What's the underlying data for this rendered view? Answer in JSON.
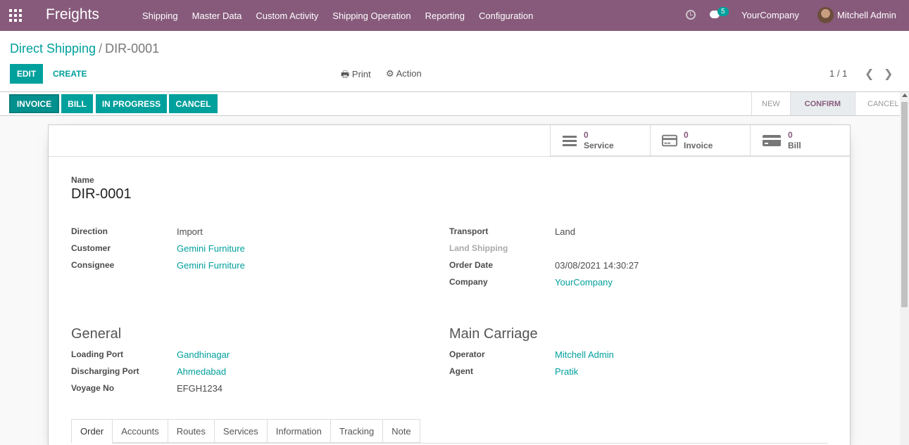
{
  "navbar": {
    "brand": "Freights",
    "menu": [
      "Shipping",
      "Master Data",
      "Custom Activity",
      "Shipping Operation",
      "Reporting",
      "Configuration"
    ],
    "message_count": "5",
    "company": "YourCompany",
    "user": "Mitchell Admin"
  },
  "breadcrumb": {
    "parent": "Direct Shipping",
    "separator": "/",
    "current": "DIR-0001"
  },
  "toolbar": {
    "edit_label": "EDIT",
    "create_label": "CREATE",
    "print_label": "Print",
    "action_label": "Action",
    "pager": "1 / 1"
  },
  "statusbar": {
    "buttons": [
      "INVOICE",
      "BILL",
      "IN PROGRESS",
      "CANCEL"
    ],
    "stages": [
      "NEW",
      "CONFIRM",
      "CANCEL"
    ],
    "active_stage": "CONFIRM"
  },
  "smart_buttons": [
    {
      "count": "0",
      "label": "Service",
      "icon": "list-icon"
    },
    {
      "count": "0",
      "label": "Invoice",
      "icon": "credit-card-icon"
    },
    {
      "count": "0",
      "label": "Bill",
      "icon": "credit-card-icon"
    }
  ],
  "record": {
    "name_label": "Name",
    "name": "DIR-0001",
    "left_fields": [
      {
        "label": "Direction",
        "value": "Import"
      },
      {
        "label": "Customer",
        "value": "Gemini Furniture"
      },
      {
        "label": "Consignee",
        "value": "Gemini Furniture"
      }
    ],
    "right_fields": [
      {
        "label": "Transport",
        "value": "Land"
      },
      {
        "label": "Land Shipping",
        "value": ""
      },
      {
        "label": "Order Date",
        "value": "03/08/2021 14:30:27"
      },
      {
        "label": "Company",
        "value": "YourCompany"
      }
    ]
  },
  "general": {
    "title": "General",
    "fields": [
      {
        "label": "Loading Port",
        "value": "Gandhinagar"
      },
      {
        "label": "Discharging Port",
        "value": "Ahmedabad"
      },
      {
        "label": "Voyage No",
        "value": "EFGH1234"
      }
    ]
  },
  "main_carriage": {
    "title": "Main Carriage",
    "fields": [
      {
        "label": "Operator",
        "value": "Mitchell Admin"
      },
      {
        "label": "Agent",
        "value": "Pratik"
      }
    ]
  },
  "tabs": [
    "Order",
    "Accounts",
    "Routes",
    "Services",
    "Information",
    "Tracking",
    "Note"
  ],
  "active_tab": "Order",
  "colors": {
    "navbar": "#875a7b",
    "primary": "#00a09d",
    "stage_active": "#875a7b"
  }
}
